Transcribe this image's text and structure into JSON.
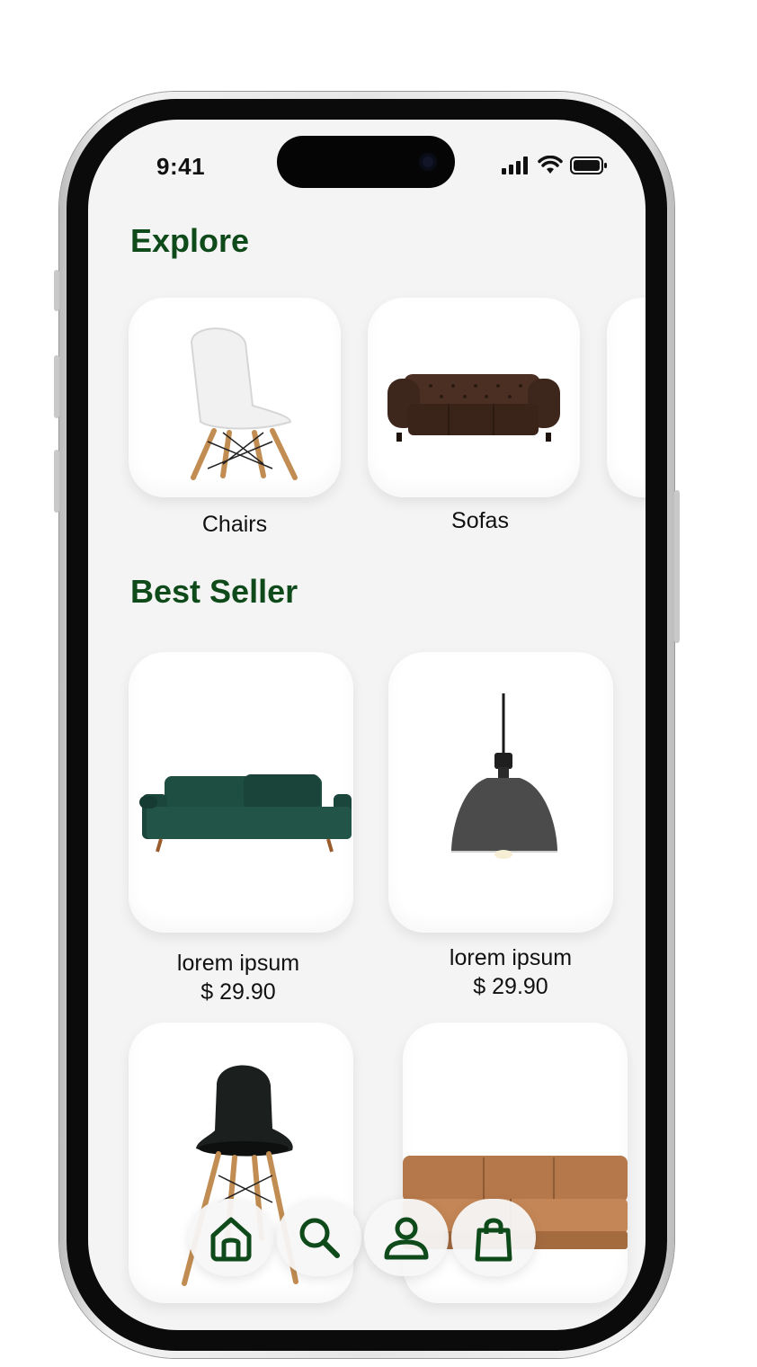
{
  "status_bar": {
    "time": "9:41"
  },
  "sections": {
    "explore_title": "Explore",
    "best_seller_title": "Best Seller"
  },
  "categories": [
    {
      "label": "Chairs",
      "icon": "white-chair-image"
    },
    {
      "label": "Sofas",
      "icon": "leather-sofa-image"
    }
  ],
  "products": [
    {
      "name": "lorem ipsum",
      "price": "$ 29.90",
      "icon": "green-sofa-image"
    },
    {
      "name": "lorem ipsum",
      "price": "$ 29.90",
      "icon": "pendant-lamp-image"
    },
    {
      "icon": "black-chair-image"
    },
    {
      "icon": "tan-sofa-image"
    }
  ],
  "nav": [
    {
      "icon": "home-icon",
      "active": true
    },
    {
      "icon": "search-icon"
    },
    {
      "icon": "profile-icon"
    },
    {
      "icon": "shopping-bag-icon"
    }
  ],
  "colors": {
    "accent": "#0f4a1a",
    "screen_bg": "#f4f4f4",
    "card_bg": "#ffffff"
  }
}
